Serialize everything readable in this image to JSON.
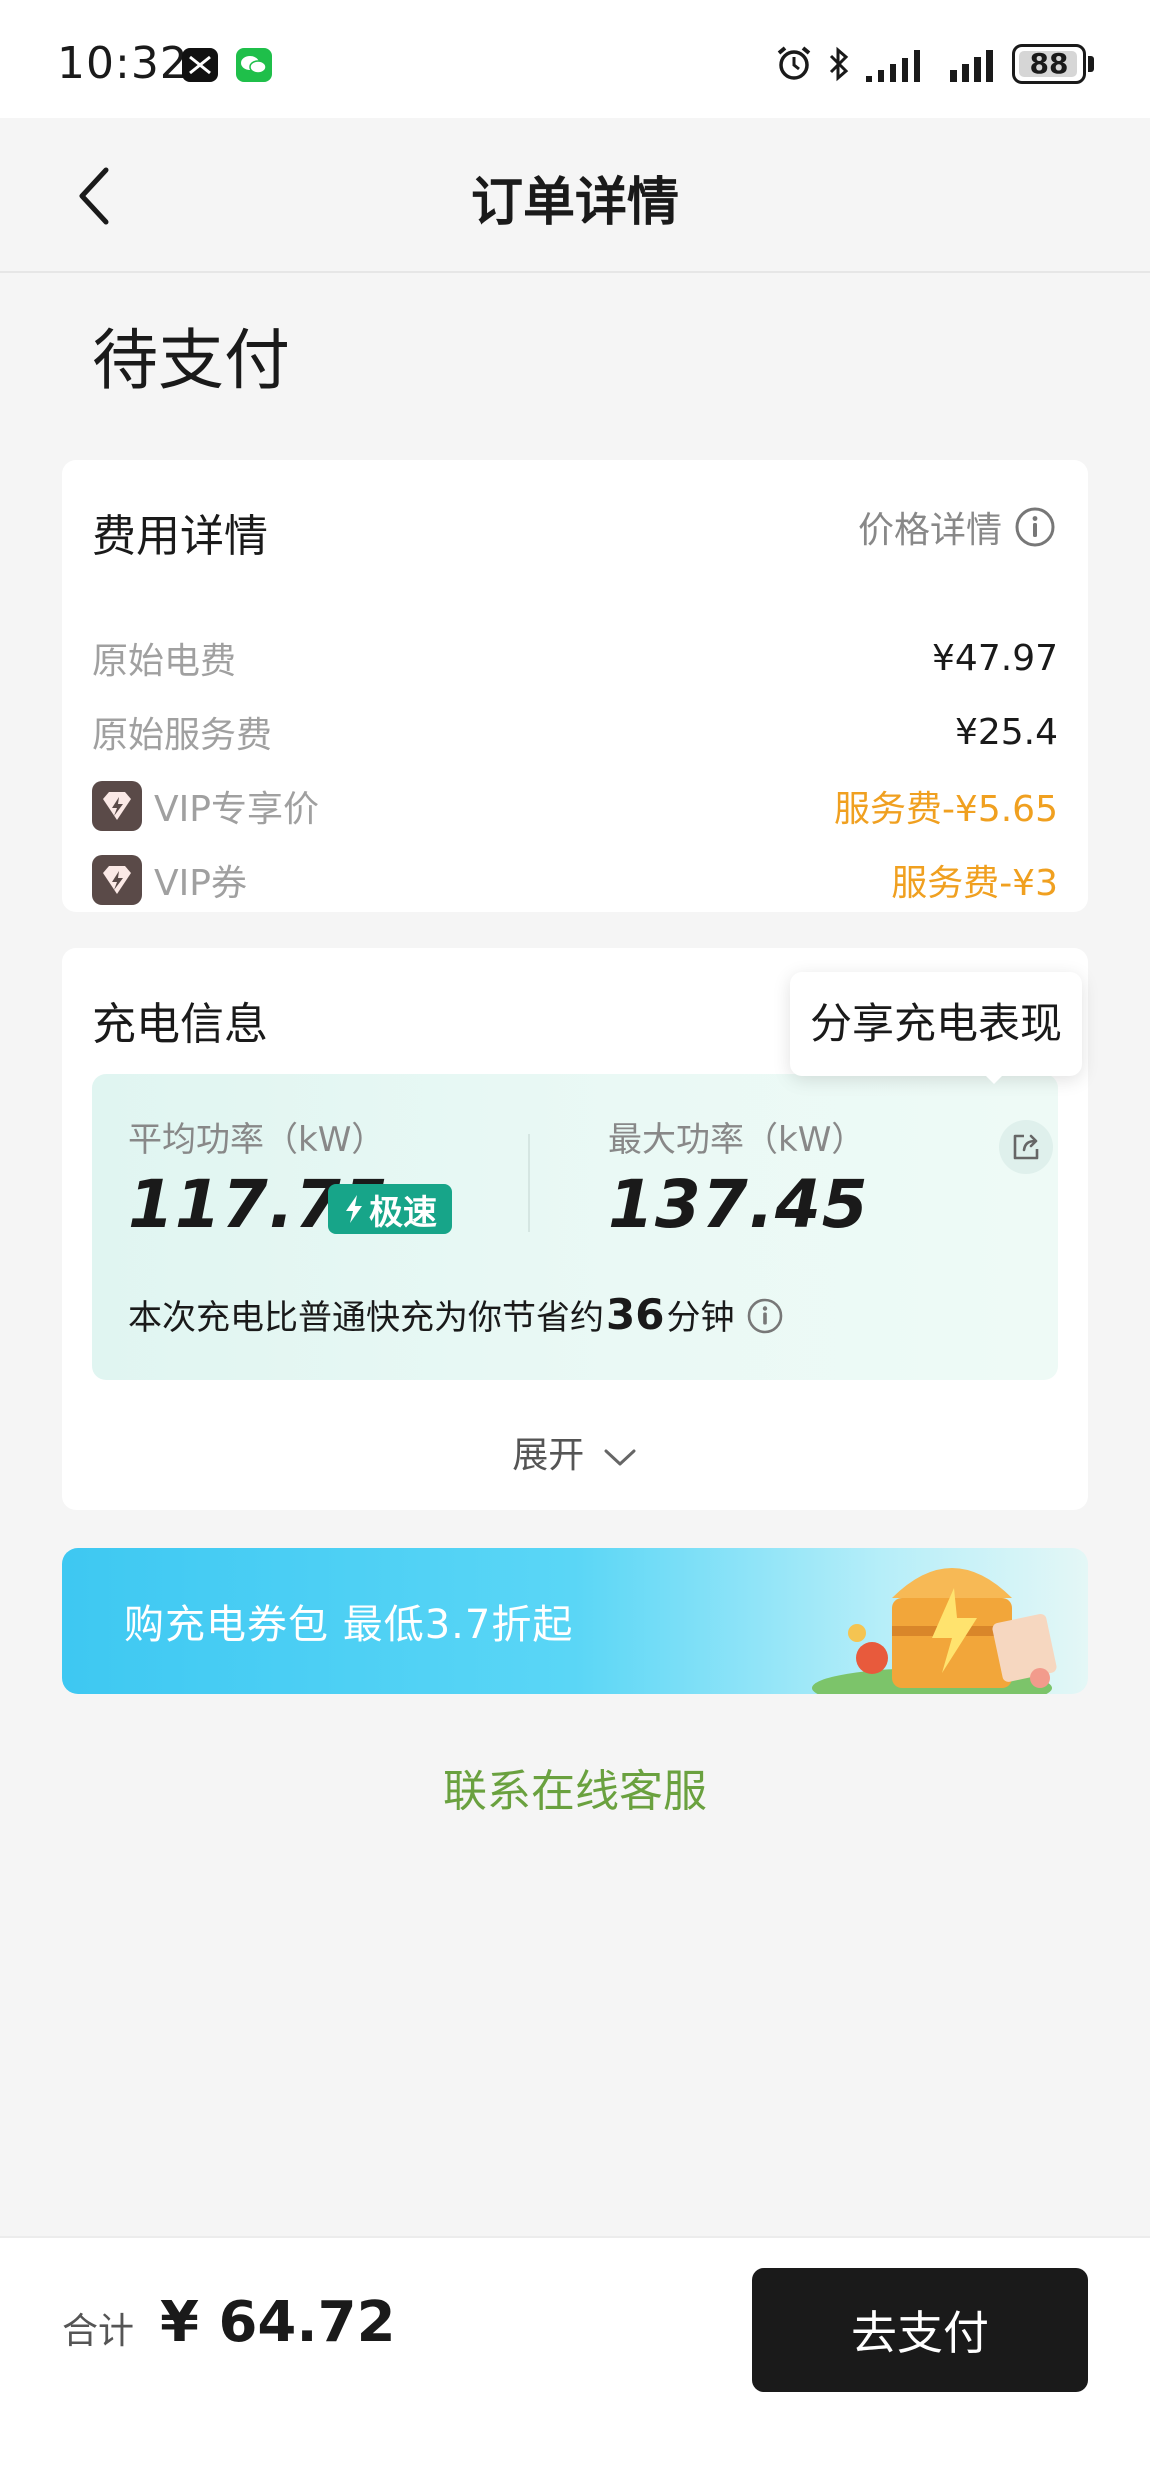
{
  "status_bar": {
    "time": "10:32",
    "battery_level": "88",
    "icons": [
      "capcut-icon",
      "wechat-icon",
      "alarm-icon",
      "bluetooth-icon",
      "signal-icon",
      "signal-icon"
    ]
  },
  "nav": {
    "title": "订单详情",
    "back_icon": "chevron-left-icon"
  },
  "order_status": "待支付",
  "fee_details": {
    "title": "费用详情",
    "price_detail_link": "价格详情",
    "rows": [
      {
        "label": "原始电费",
        "value": "¥47.97"
      },
      {
        "label": "原始服务费",
        "value": "¥25.4"
      },
      {
        "label": "VIP专享价",
        "value": "服务费-¥5.65",
        "highlight": true,
        "icon": "vip-badge-icon"
      },
      {
        "label": "VIP券",
        "value": "服务费-¥3",
        "highlight": true,
        "icon": "vip-badge-icon"
      }
    ]
  },
  "charge_info": {
    "title": "充电信息",
    "share_tooltip": "分享充电表现",
    "avg_power_label": "平均功率（kW）",
    "avg_power_value": "117.75",
    "fast_badge": "极速",
    "max_power_label": "最大功率（kW）",
    "max_power_value": "137.45",
    "save_prefix": "本次充电比普通快充为你节省约",
    "save_minutes": "36",
    "save_suffix": "分钟",
    "expand_label": "展开"
  },
  "promo": {
    "text": "购充电券包 最低3.7折起"
  },
  "service_link": "联系在线客服",
  "bottom": {
    "total_label": "合计",
    "total_amount": "¥ 64.72",
    "pay_button": "去支付"
  },
  "colors": {
    "accent_orange": "#f0a020",
    "fast_green": "#17a589",
    "service_green": "#6aa13f",
    "pay_button_bg": "#1a1a1a"
  }
}
